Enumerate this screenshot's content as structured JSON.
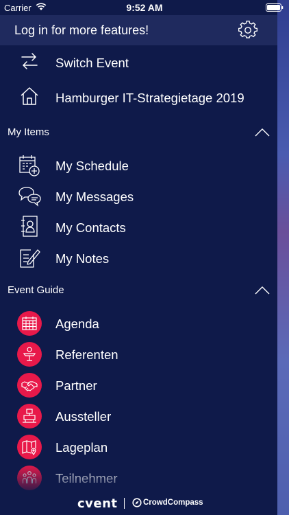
{
  "status_bar": {
    "carrier": "Carrier",
    "time": "9:52 AM"
  },
  "header": {
    "title": "Log in for more features!",
    "settings_icon": "gear-icon"
  },
  "top_items": [
    {
      "label": "Switch Event",
      "icon": "switch-arrows-icon"
    },
    {
      "label": "Hamburger IT-Strategietage 2019",
      "icon": "home-icon"
    }
  ],
  "my_items": {
    "title": "My Items",
    "items": [
      {
        "label": "My Schedule",
        "icon": "calendar-add-icon"
      },
      {
        "label": "My Messages",
        "icon": "chat-bubbles-icon"
      },
      {
        "label": "My Contacts",
        "icon": "contact-book-icon"
      },
      {
        "label": "My Notes",
        "icon": "note-pencil-icon"
      }
    ]
  },
  "event_guide": {
    "title": "Event Guide",
    "items": [
      {
        "label": "Agenda",
        "icon": "calendar-grid-icon"
      },
      {
        "label": "Referenten",
        "icon": "speaker-podium-icon"
      },
      {
        "label": "Partner",
        "icon": "handshake-icon"
      },
      {
        "label": "Aussteller",
        "icon": "exhibitor-booth-icon"
      },
      {
        "label": "Lageplan",
        "icon": "map-pin-icon"
      },
      {
        "label": "Teilnehmer",
        "icon": "people-group-icon"
      }
    ]
  },
  "footer": {
    "brand": "cvent",
    "partner": "CrowdCompass"
  },
  "colors": {
    "background": "#0f1a4a",
    "header": "#1f2a5e",
    "accent": "#e8194a"
  }
}
